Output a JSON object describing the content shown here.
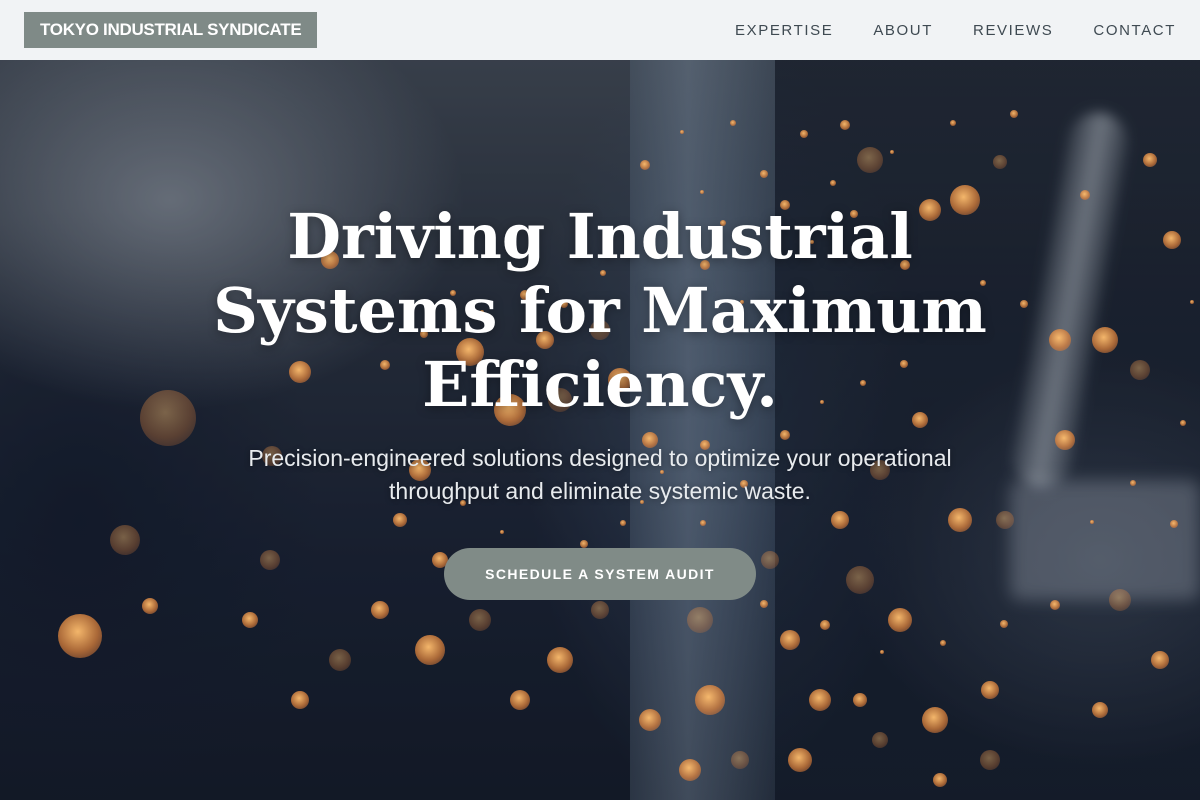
{
  "header": {
    "brand": "TOKYO INDUSTRIAL SYNDICATE",
    "nav": [
      {
        "label": "EXPERTISE"
      },
      {
        "label": "ABOUT"
      },
      {
        "label": "REVIEWS"
      },
      {
        "label": "CONTACT"
      }
    ]
  },
  "hero": {
    "headline": "Driving Industrial Systems for Maximum Efficiency.",
    "subtext": "Precision-engineered solutions designed to optimize your operational throughput and eliminate systemic waste.",
    "cta_label": "SCHEDULE A SYSTEM AUDIT"
  },
  "colors": {
    "header_bg": "#f1f3f5",
    "brand_bg": "#7f8a87",
    "cta_bg": "#808b87",
    "nav_text": "#3f4a52",
    "headline_text": "#ffffff"
  }
}
